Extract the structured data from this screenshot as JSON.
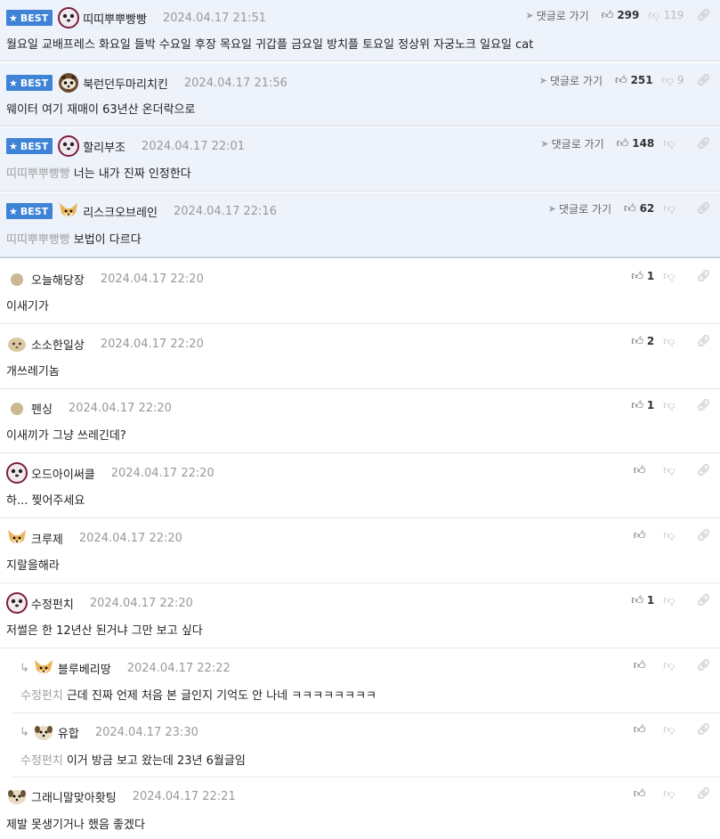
{
  "labels": {
    "best": "BEST",
    "goto_reply": "댓글로 가기"
  },
  "comments": [
    {
      "best": true,
      "avatar": "panda",
      "nick": "띠띠뿌뿌빵빵",
      "date": "2024.04.17 21:51",
      "mention": "",
      "text": "월요일 교배프레스 화요일 들박 수요일 후장 목요일 귀갑플 금요일 방치플 토요일 정상위 자궁노크 일요일 cat",
      "likes": "299",
      "dislikes": "119"
    },
    {
      "best": true,
      "avatar": "raccoon",
      "nick": "북런던두마리치킨",
      "date": "2024.04.17 21:56",
      "mention": "",
      "text": "웨이터 여기 재매이 63년산 온더락으로",
      "likes": "251",
      "dislikes": "9"
    },
    {
      "best": true,
      "avatar": "panda",
      "nick": "할리부조",
      "date": "2024.04.17 22:01",
      "mention": "띠띠뿌뿌빵빵",
      "text": "너는 내가 진짜 인정한다",
      "likes": "148",
      "dislikes": ""
    },
    {
      "best": true,
      "avatar": "fox",
      "nick": "리스크오브레인",
      "date": "2024.04.17 22:16",
      "mention": "띠띠뿌뿌빵빵",
      "text": "보법이 다르다",
      "likes": "62",
      "dislikes": ""
    },
    {
      "best": false,
      "avatar": "dot",
      "nick": "오늘해당장",
      "date": "2024.04.17 22:20",
      "mention": "",
      "text": "이새기가",
      "likes": "1",
      "dislikes": ""
    },
    {
      "best": false,
      "avatar": "blob",
      "nick": "소소한일상",
      "date": "2024.04.17 22:20",
      "mention": "",
      "text": "개쓰레기놈",
      "likes": "2",
      "dislikes": ""
    },
    {
      "best": false,
      "avatar": "dot",
      "nick": "펜싱",
      "date": "2024.04.17 22:20",
      "mention": "",
      "text": "이새끼가 그냥 쓰레긴데?",
      "likes": "1",
      "dislikes": ""
    },
    {
      "best": false,
      "avatar": "panda",
      "nick": "오드아이써클",
      "date": "2024.04.17 22:20",
      "mention": "",
      "text": "하... 찢어주세요",
      "likes": "",
      "dislikes": ""
    },
    {
      "best": false,
      "avatar": "fox",
      "nick": "크루제",
      "date": "2024.04.17 22:20",
      "mention": "",
      "text": "지랄을해라",
      "likes": "",
      "dislikes": ""
    },
    {
      "best": false,
      "avatar": "panda",
      "nick": "수정펀치",
      "date": "2024.04.17 22:20",
      "mention": "",
      "text": "저썰은 한 12년산 된거냐 그만 보고 싶다",
      "likes": "1",
      "dislikes": ""
    },
    {
      "best": false,
      "reply": true,
      "avatar": "fox",
      "nick": "블루베리땅",
      "date": "2024.04.17 22:22",
      "mention": "수정펀치",
      "text": "근데 진짜 언제 처음 본 글인지 기억도 안 나네 ㅋㅋㅋㅋㅋㅋㅋㅋ",
      "likes": "",
      "dislikes": ""
    },
    {
      "best": false,
      "reply": true,
      "avatar": "puppy",
      "nick": "유합",
      "date": "2024.04.17 23:30",
      "mention": "수정펀치",
      "text": "이거 방금 보고 왔는데 23년 6월글임",
      "likes": "",
      "dislikes": ""
    },
    {
      "best": false,
      "avatar": "puppy",
      "nick": "그래니말맞아홧팅",
      "date": "2024.04.17 22:21",
      "mention": "",
      "text": "제발 못생기거나 했음 좋겠다",
      "likes": "",
      "dislikes": ""
    }
  ]
}
